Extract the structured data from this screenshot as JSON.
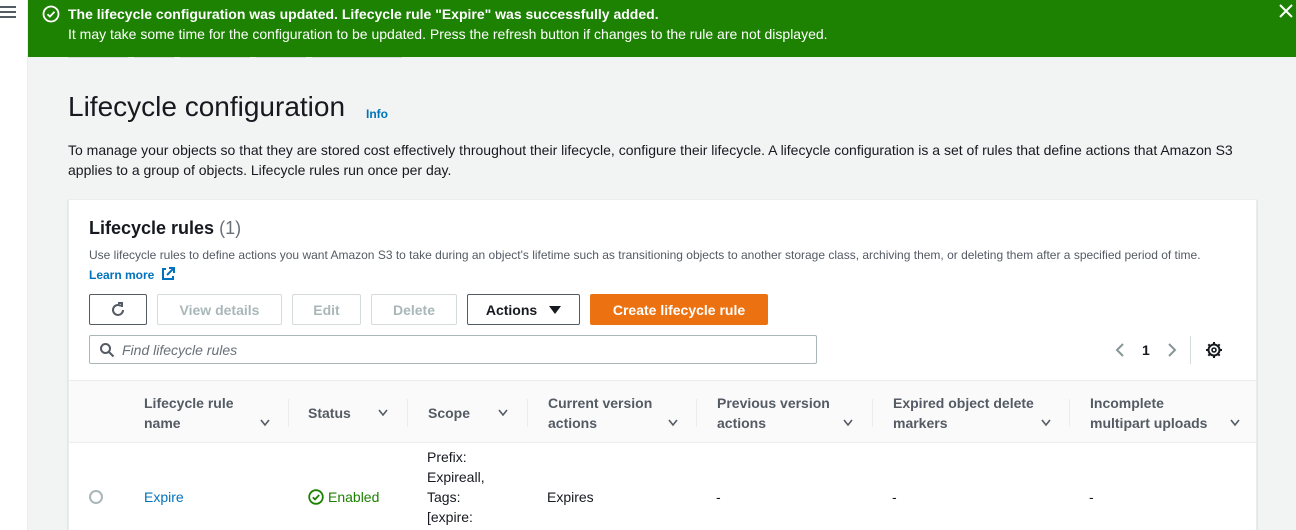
{
  "flash": {
    "title": "The lifecycle configuration was updated. Lifecycle rule \"Expire\" was successfully added.",
    "message": "It may take some time for the configuration to be updated. Press the refresh button if changes to the rule are not displayed.",
    "background": "#1d8102"
  },
  "page": {
    "title": "Lifecycle configuration",
    "info": "Info",
    "description": "To manage your objects so that they are stored cost effectively throughout their lifecycle, configure their lifecycle. A lifecycle configuration is a set of rules that define actions that Amazon S3 applies to a group of objects. Lifecycle rules run once per day."
  },
  "panel": {
    "title": "Lifecycle rules",
    "count": "(1)",
    "description": "Use lifecycle rules to define actions you want Amazon S3 to take during an object's lifetime such as transitioning objects to another storage class, archiving them, or deleting them after a specified period of time.",
    "learn_more": "Learn more"
  },
  "toolbar": {
    "view_details": "View details",
    "edit": "Edit",
    "delete": "Delete",
    "actions": "Actions",
    "create": "Create lifecycle rule",
    "primary_color": "#ec7211"
  },
  "search": {
    "placeholder": "Find lifecycle rules",
    "value": ""
  },
  "pagination": {
    "page": "1"
  },
  "table": {
    "columns": [
      {
        "line1": "Lifecycle rule",
        "line2": "name"
      },
      {
        "line1": "Status",
        "line2": ""
      },
      {
        "line1": "Scope",
        "line2": ""
      },
      {
        "line1": "Current version",
        "line2": "actions"
      },
      {
        "line1": "Previous version",
        "line2": "actions"
      },
      {
        "line1": "Expired object delete",
        "line2": "markers"
      },
      {
        "line1": "Incomplete",
        "line2": "multipart uploads"
      }
    ],
    "rows": [
      {
        "name": "Expire",
        "status": "Enabled",
        "scope": [
          "Prefix:",
          "Expireall,",
          "Tags:",
          "[expire:"
        ],
        "current_version_actions": "Expires",
        "previous_version_actions": "-",
        "expired_object_delete_markers": "-",
        "incomplete_multipart_uploads": "-"
      }
    ]
  },
  "icons": {
    "menu": "hamburger-menu-icon",
    "success": "check-circle-icon",
    "close": "close-icon",
    "refresh": "refresh-icon",
    "search": "search-icon",
    "settings": "gear-icon",
    "external": "external-link-icon"
  }
}
